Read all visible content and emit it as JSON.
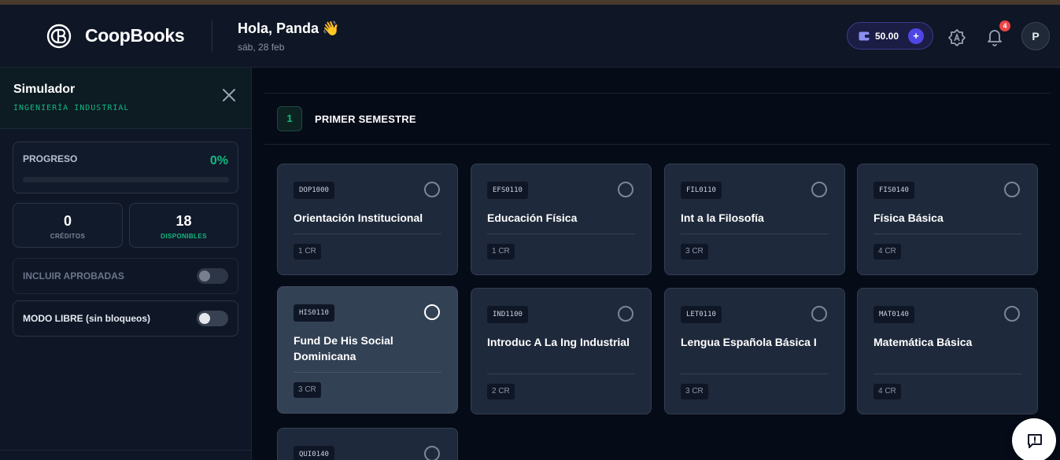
{
  "header": {
    "brand": "CoopBooks",
    "greeting": "Hola, Panda",
    "greeting_emoji": "👋",
    "date": "sáb, 28 feb",
    "wallet_amount": "50.00",
    "wallet_add": "+",
    "notifications_count": "4",
    "avatar_initial": "P"
  },
  "sidebar": {
    "title": "Simulador",
    "subtitle": "INGENIERÍA INDUSTRIAL",
    "progress_label": "PROGRESO",
    "progress_value": "0%",
    "progress_fraction": 0,
    "credits_value": "0",
    "credits_label": "CRÉDITOS",
    "available_value": "18",
    "available_label": "DISPONIBLES",
    "toggle_include_approved": "INCLUIR APROBADAS",
    "toggle_free_mode": "MODO LIBRE (sin bloqueos)"
  },
  "semester": {
    "number": "1",
    "title": "PRIMER SEMESTRE"
  },
  "courses": [
    {
      "code": "DOP1000",
      "name": "Orientación Institucional",
      "credits": "1 CR"
    },
    {
      "code": "EFS0110",
      "name": "Educación Física",
      "credits": "1 CR"
    },
    {
      "code": "FIL0110",
      "name": "Int a la Filosofía",
      "credits": "3 CR"
    },
    {
      "code": "FIS0140",
      "name": "Física Básica",
      "credits": "4 CR"
    },
    {
      "code": "HIS0110",
      "name": "Fund De His Social Dominicana",
      "credits": "3 CR"
    },
    {
      "code": "IND1100",
      "name": "Introduc A La Ing Industrial",
      "credits": "2 CR"
    },
    {
      "code": "LET0110",
      "name": "Lengua Española Básica I",
      "credits": "3 CR"
    },
    {
      "code": "MAT0140",
      "name": "Matemática Básica",
      "credits": "4 CR"
    },
    {
      "code": "QUI0140",
      "name": "",
      "credits": ""
    }
  ],
  "colors": {
    "accent_green": "#10b981",
    "brand_indigo": "#4f46e5",
    "badge_red": "#ef4444"
  }
}
